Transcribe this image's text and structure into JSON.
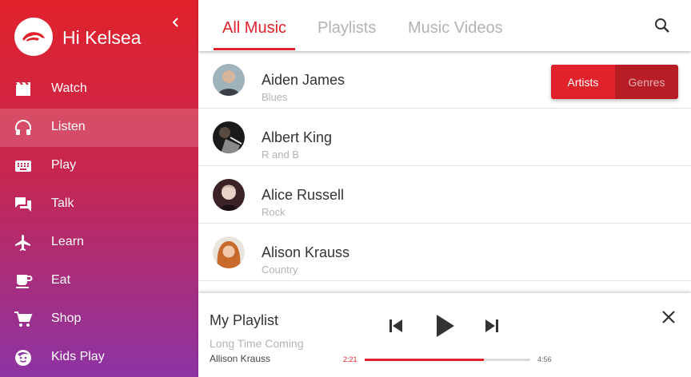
{
  "user": {
    "greeting": "Hi Kelsea"
  },
  "sidebar": {
    "items": [
      {
        "label": "Watch",
        "icon": "film-icon",
        "active": false
      },
      {
        "label": "Listen",
        "icon": "headphones-icon",
        "active": true
      },
      {
        "label": "Play",
        "icon": "keyboard-icon",
        "active": false
      },
      {
        "label": "Talk",
        "icon": "chat-icon",
        "active": false
      },
      {
        "label": "Learn",
        "icon": "airplane-icon",
        "active": false
      },
      {
        "label": "Eat",
        "icon": "coffee-cup-icon",
        "active": false
      },
      {
        "label": "Shop",
        "icon": "shopping-cart-icon",
        "active": false
      },
      {
        "label": "Kids Play",
        "icon": "child-face-icon",
        "active": false
      }
    ]
  },
  "tabs": [
    {
      "label": "All Music",
      "active": true
    },
    {
      "label": "Playlists",
      "active": false
    },
    {
      "label": "Music Videos",
      "active": false
    }
  ],
  "toggle": {
    "artists_label": "Artists",
    "genres_label": "Genres",
    "selected": "Artists"
  },
  "artists": [
    {
      "name": "Aiden James",
      "genre": "Blues"
    },
    {
      "name": "Albert King",
      "genre": "R and B"
    },
    {
      "name": "Alice Russell",
      "genre": "Rock"
    },
    {
      "name": "Alison Krauss",
      "genre": "Country"
    }
  ],
  "player": {
    "playlist_title": "My Playlist",
    "track_title": "Long Time Coming",
    "track_artist": "Allison Krauss",
    "current_time": "2:21",
    "total_time": "4:56",
    "progress": 0.72
  },
  "colors": {
    "accent": "#e1222b",
    "sidebar_top": "#e1222b",
    "sidebar_bottom": "#8d33a4"
  }
}
